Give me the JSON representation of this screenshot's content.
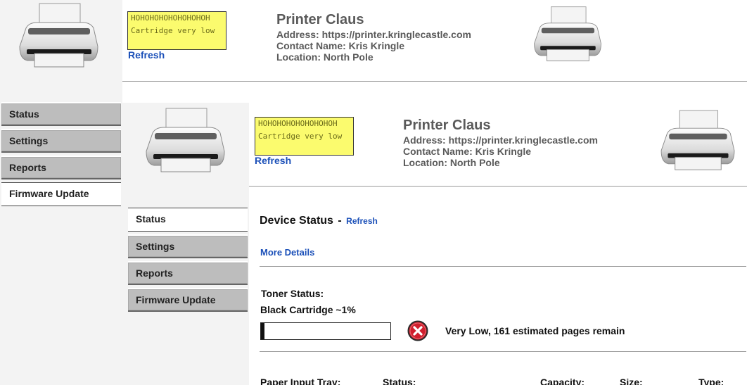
{
  "printer": {
    "alert_title": "HOHOHOHOHOHOHOHOH",
    "alert_message": "Cartridge very low",
    "refresh_label": "Refresh",
    "name": "Printer Claus",
    "address_line": "Address: https://printer.kringlecastle.com",
    "contact_line": "Contact Name: Kris Kringle",
    "location_line": "Location: North Pole"
  },
  "nav": {
    "items": [
      {
        "label": "Status"
      },
      {
        "label": "Settings"
      },
      {
        "label": "Reports"
      },
      {
        "label": "Firmware Update"
      }
    ],
    "outer_active": "Firmware Update",
    "inner_active": "Status"
  },
  "device_status": {
    "title": "Device Status",
    "separator": "-",
    "refresh_label": "Refresh",
    "more_details_label": "More Details",
    "toner_status_label": "Toner Status:",
    "cartridge_label": "Black Cartridge ~1%",
    "toner_level_percent": 1,
    "toner_status_text": "Very Low, 161 estimated pages remain"
  },
  "paper_table": {
    "headers": [
      "Paper Input Tray:",
      "Status:",
      "Capacity:",
      "Size:",
      "Type:"
    ]
  },
  "icons": {
    "printer": "printer-icon",
    "error": "error-icon"
  },
  "colors": {
    "alert_bg": "#fbfb6e",
    "link": "#1a4fb8",
    "error": "#d01f2e"
  }
}
